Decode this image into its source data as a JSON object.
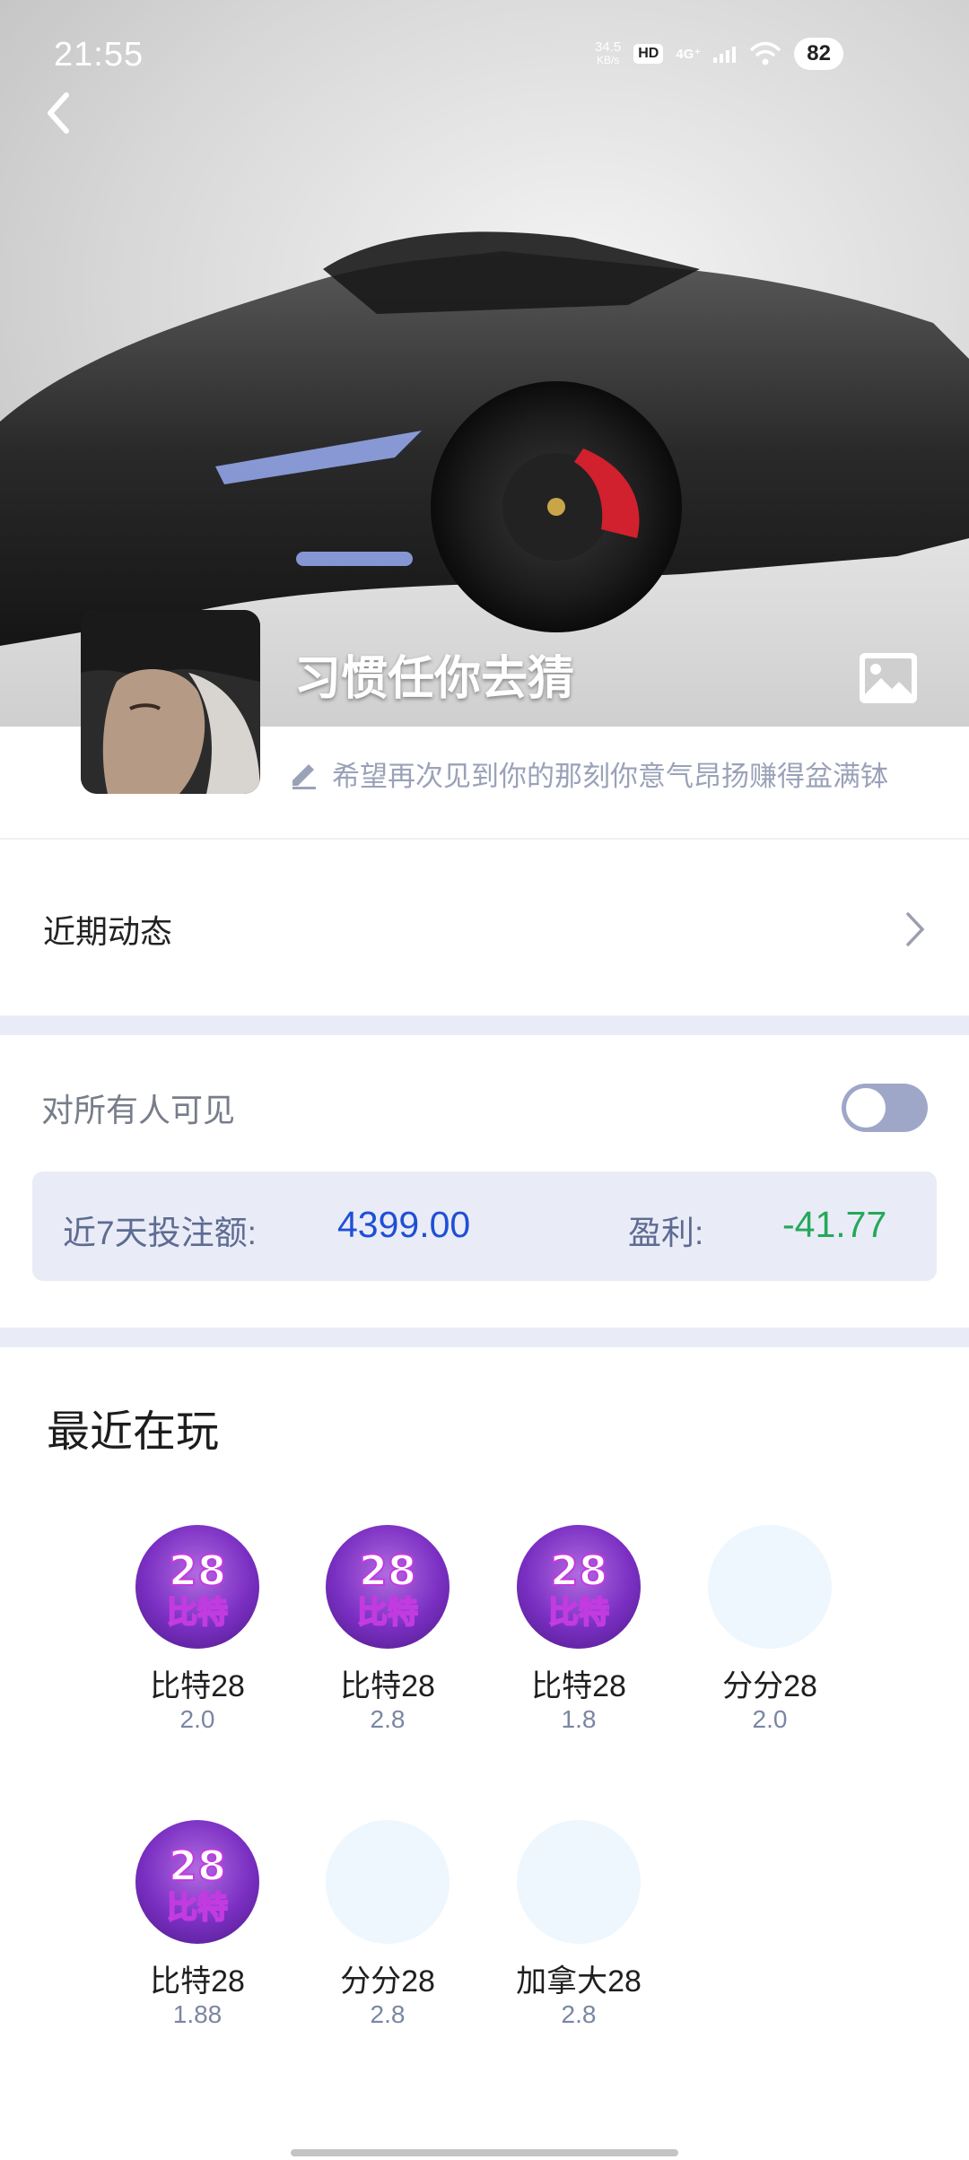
{
  "status_bar": {
    "time": "21:55",
    "net_speed_value": "34.5",
    "net_speed_unit": "KB/s",
    "hd_badge": "HD",
    "network": "4G⁺",
    "battery": "82"
  },
  "profile": {
    "nickname": "习惯任你去猜",
    "signature": "希望再次见到你的那刻你意气昂扬赚得盆满钵"
  },
  "recent_activity": {
    "label": "近期动态"
  },
  "visibility": {
    "label": "对所有人可见",
    "enabled": false
  },
  "stats": {
    "bet_label": "近7天投注额:",
    "bet_value": "4399.00",
    "profit_label": "盈利:",
    "profit_value": "-41.77"
  },
  "recent_games": {
    "title": "最近在玩",
    "items": [
      {
        "name": "比特28",
        "odds": "2.0",
        "icon_text": "28\n比特"
      },
      {
        "name": "比特28",
        "odds": "2.8",
        "icon_text": "28\n比特"
      },
      {
        "name": "比特28",
        "odds": "1.8",
        "icon_text": "28\n比特"
      },
      {
        "name": "分分28",
        "odds": "2.0"
      },
      {
        "name": "比特28",
        "odds": "1.88",
        "icon_text": "28\n比特"
      },
      {
        "name": "分分28",
        "odds": "2.8"
      },
      {
        "name": "加拿大28",
        "odds": "2.8"
      }
    ]
  },
  "colors": {
    "accent_blue": "#1f4fd6",
    "profit_green": "#24a85a",
    "section_bg": "#e9ecf6",
    "toggle_off": "#9ea7c8"
  },
  "icons": {
    "back": "chevron-left-icon",
    "background_image": "image-icon",
    "edit_signature": "pencil-icon",
    "recent_activity_arrow": "chevron-right-icon"
  }
}
